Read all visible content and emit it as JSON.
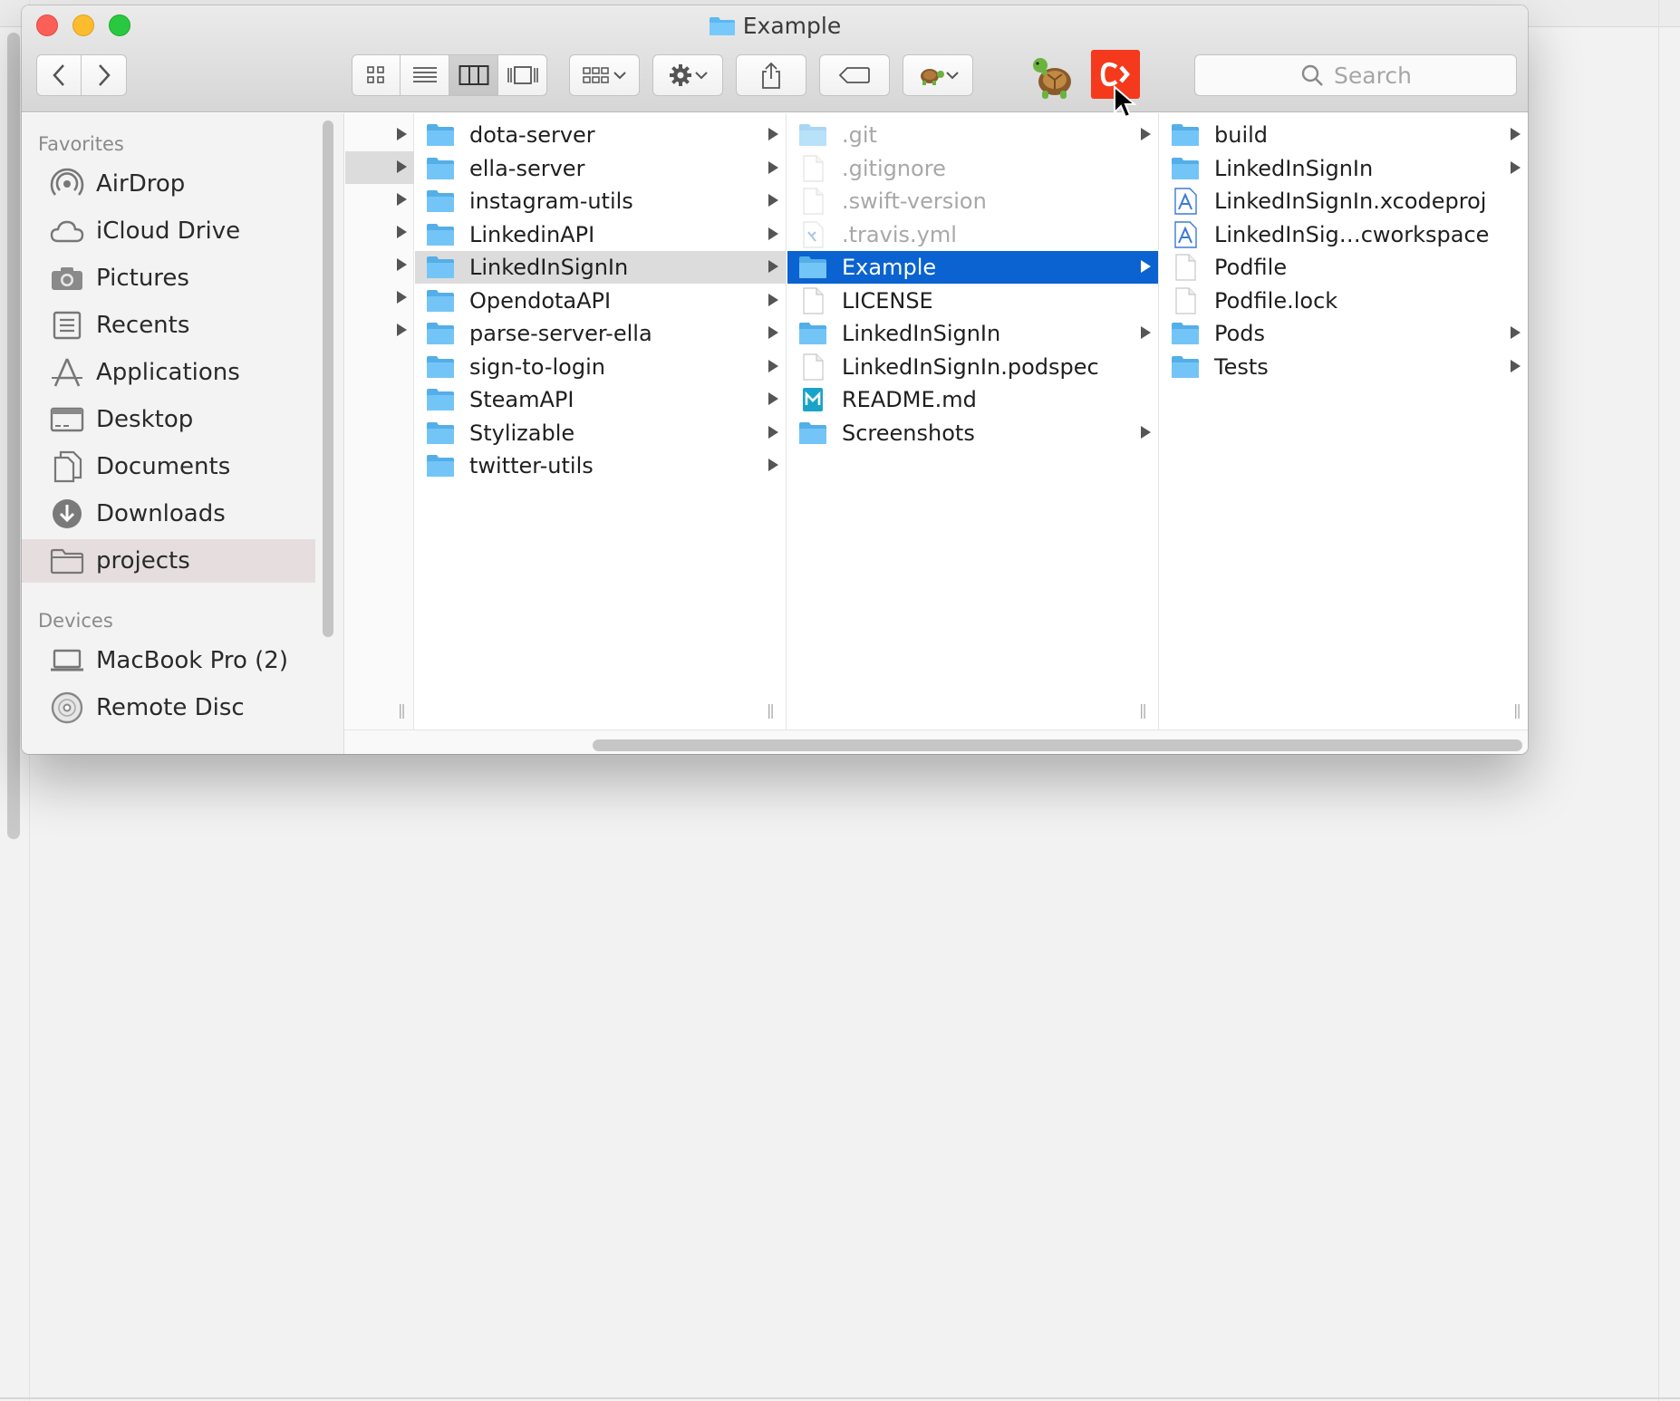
{
  "window": {
    "title": "Example"
  },
  "toolbar": {
    "search_placeholder": "Search",
    "view_modes": [
      "icon-view",
      "list-view",
      "column-view",
      "gallery-view"
    ],
    "active_view": "column-view",
    "app_badge_color": "#f5391d"
  },
  "sidebar": {
    "favorites_header": "Favorites",
    "favorites": [
      {
        "label": "AirDrop",
        "icon": "airdrop-icon"
      },
      {
        "label": "iCloud Drive",
        "icon": "cloud-icon"
      },
      {
        "label": "Pictures",
        "icon": "camera-icon"
      },
      {
        "label": "Recents",
        "icon": "recents-icon"
      },
      {
        "label": "Applications",
        "icon": "applications-icon"
      },
      {
        "label": "Desktop",
        "icon": "desktop-icon"
      },
      {
        "label": "Documents",
        "icon": "documents-icon"
      },
      {
        "label": "Downloads",
        "icon": "downloads-icon"
      },
      {
        "label": "projects",
        "icon": "folder-icon",
        "selected": true
      }
    ],
    "devices_header": "Devices",
    "devices": [
      {
        "label": "MacBook Pro (2)",
        "icon": "laptop-icon"
      },
      {
        "label": "Remote Disc",
        "icon": "disc-icon"
      }
    ]
  },
  "columns": {
    "col1": [
      {
        "label": "dota-server",
        "type": "folder"
      },
      {
        "label": "ella-server",
        "type": "folder"
      },
      {
        "label": "instagram-utils",
        "type": "folder"
      },
      {
        "label": "LinkedinAPI",
        "type": "folder"
      },
      {
        "label": "LinkedInSignIn",
        "type": "folder",
        "selected": "gray"
      },
      {
        "label": "OpendotaAPI",
        "type": "folder"
      },
      {
        "label": "parse-server-ella",
        "type": "folder"
      },
      {
        "label": "sign-to-login",
        "type": "folder"
      },
      {
        "label": "SteamAPI",
        "type": "folder"
      },
      {
        "label": "Stylizable",
        "type": "folder"
      },
      {
        "label": "twitter-utils",
        "type": "folder"
      }
    ],
    "col2": [
      {
        "label": ".git",
        "type": "folder",
        "dim": true
      },
      {
        "label": ".gitignore",
        "type": "file",
        "dim": true
      },
      {
        "label": ".swift-version",
        "type": "file",
        "dim": true
      },
      {
        "label": ".travis.yml",
        "type": "code",
        "dim": true
      },
      {
        "label": "Example",
        "type": "folder",
        "selected": "blue"
      },
      {
        "label": "LICENSE",
        "type": "file"
      },
      {
        "label": "LinkedInSignIn",
        "type": "folder"
      },
      {
        "label": "LinkedInSignIn.podspec",
        "type": "file"
      },
      {
        "label": "README.md",
        "type": "markdown"
      },
      {
        "label": "Screenshots",
        "type": "folder"
      }
    ],
    "col3": [
      {
        "label": "build",
        "type": "folder"
      },
      {
        "label": "LinkedInSignIn",
        "type": "folder"
      },
      {
        "label": "LinkedInSignIn.xcodeproj",
        "type": "xcode"
      },
      {
        "label": "LinkedInSig…cworkspace",
        "type": "xcode"
      },
      {
        "label": "Podfile",
        "type": "file"
      },
      {
        "label": "Podfile.lock",
        "type": "file"
      },
      {
        "label": "Pods",
        "type": "folder"
      },
      {
        "label": "Tests",
        "type": "folder"
      }
    ]
  }
}
